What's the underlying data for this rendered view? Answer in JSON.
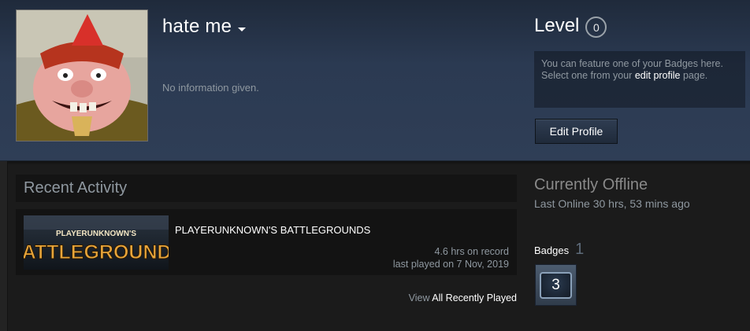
{
  "profile": {
    "persona_name": "hate me",
    "summary": "No information given."
  },
  "level": {
    "label": "Level",
    "value": "0"
  },
  "badge_feature": {
    "text_before": "You can feature one of your Badges here. Select one from your ",
    "link_text": "edit profile",
    "text_after": " page."
  },
  "edit_profile_label": "Edit Profile",
  "recent_activity": {
    "title": "Recent Activity",
    "games": [
      {
        "name": "PLAYERUNKNOWN'S BATTLEGROUNDS",
        "capsule_top": "PLAYERUNKNOWN'S",
        "capsule_bottom": "BATTLEGROUNDS",
        "hours": "4.6 hrs on record",
        "last_played": "last played on 7 Nov, 2019"
      }
    ],
    "view_prefix": "View ",
    "view_link": "All Recently Played"
  },
  "status": {
    "title": "Currently Offline",
    "last_online": "Last Online 30 hrs, 53 mins ago"
  },
  "badges": {
    "label": "Badges",
    "count": "1",
    "items": [
      {
        "value": "3"
      }
    ]
  },
  "colors": {
    "header_bg": "#2b3a52",
    "page_bg": "#1b1b1b",
    "muted_text": "#8f98a0",
    "capsule_text": "#e8a53a"
  },
  "icons": {
    "persona_dropdown": "caret-down-icon"
  }
}
